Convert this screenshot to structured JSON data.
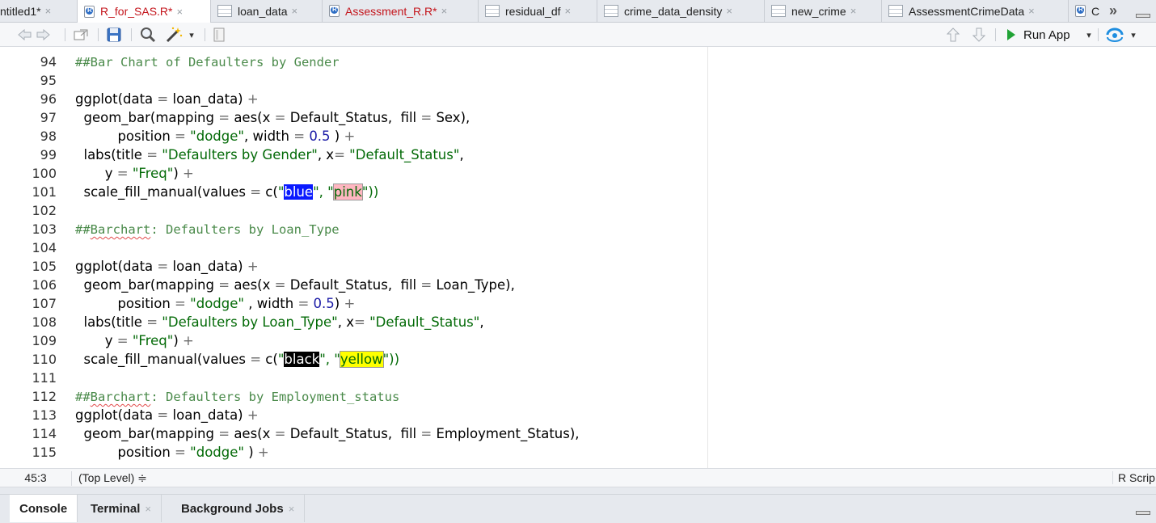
{
  "tabs": [
    {
      "label": "ntitled1*",
      "icon": "none",
      "modified": false,
      "active": false
    },
    {
      "label": "R_for_SAS.R*",
      "icon": "r-file-icon",
      "modified": true,
      "active": true
    },
    {
      "label": "loan_data",
      "icon": "table-icon",
      "modified": false,
      "active": false
    },
    {
      "label": "Assessment_R.R*",
      "icon": "r-file-icon",
      "modified": true,
      "active": false
    },
    {
      "label": "residual_df",
      "icon": "table-icon",
      "modified": false,
      "active": false
    },
    {
      "label": "crime_data_density",
      "icon": "table-icon",
      "modified": false,
      "active": false
    },
    {
      "label": "new_crime",
      "icon": "table-icon",
      "modified": false,
      "active": false
    },
    {
      "label": "AssessmentCrimeData",
      "icon": "table-icon",
      "modified": false,
      "active": false
    },
    {
      "label": "C",
      "icon": "r-file-icon",
      "modified": false,
      "active": false
    }
  ],
  "tab_close_glyph": "×",
  "overflow_glyph": "»",
  "toolbar": {
    "run_app_label": "Run App",
    "dropdown_glyph": "▾"
  },
  "editor": {
    "lines": [
      {
        "n": "94"
      },
      {
        "n": "95"
      },
      {
        "n": "96"
      },
      {
        "n": "97"
      },
      {
        "n": "98"
      },
      {
        "n": "99"
      },
      {
        "n": "100"
      },
      {
        "n": "101"
      },
      {
        "n": "102"
      },
      {
        "n": "103"
      },
      {
        "n": "104"
      },
      {
        "n": "105"
      },
      {
        "n": "106"
      },
      {
        "n": "107"
      },
      {
        "n": "108"
      },
      {
        "n": "109"
      },
      {
        "n": "110"
      },
      {
        "n": "111"
      },
      {
        "n": "112"
      },
      {
        "n": "113"
      },
      {
        "n": "114"
      },
      {
        "n": "115"
      }
    ],
    "code": {
      "c94": "##Bar Chart of Defaulters by Gender",
      "c103a": "##",
      "c103b": "Barchart",
      "c103c": ": Defaulters by Loan_Type",
      "c112a": "##",
      "c112b": "Barchart",
      "c112c": ": Defaulters by Employment_status",
      "ggplot": "ggplot(data",
      "loan": " loan_data)",
      "geom": "  geom_bar(mapping",
      "aes": " aes(x",
      "ds": " Default_Status,  fill",
      "sex": " Sex),",
      "lt": " Loan_Type),",
      "es": " Employment_Status),",
      "pos": "          position",
      "dodge": "\"dodge\"",
      "width": ", width",
      "width2": " , width",
      "w": "0.5",
      "labs": "  labs(title",
      "t1": "\"Defaulters by Gender\"",
      "t2": "\"Defaulters by Loan_Type\"",
      "xeq": ", x",
      "xds": "\"Default_Status\"",
      "yeq": "       y",
      "freq": "\"Freq\"",
      "sfm": "  scale_fill_manual(values",
      "c": " c(",
      "blue": "blue",
      "pink": "pink",
      "black": "black",
      "yellow": "yellow",
      "q": "\"",
      "qcomma": "\", \"",
      "close": "\"))",
      "eq": " =",
      "plus": " +",
      "close_paren": ")",
      "close_paren_sp": " )",
      "comma": ","
    }
  },
  "status": {
    "cursor": "45:3",
    "scope": "(Top Level) ≑",
    "file_type": "R Scrip"
  },
  "console_tabs": [
    {
      "label": "Console",
      "active": true,
      "closable": false
    },
    {
      "label": "Terminal",
      "active": false,
      "closable": true
    },
    {
      "label": "Background Jobs",
      "active": false,
      "closable": true
    }
  ]
}
